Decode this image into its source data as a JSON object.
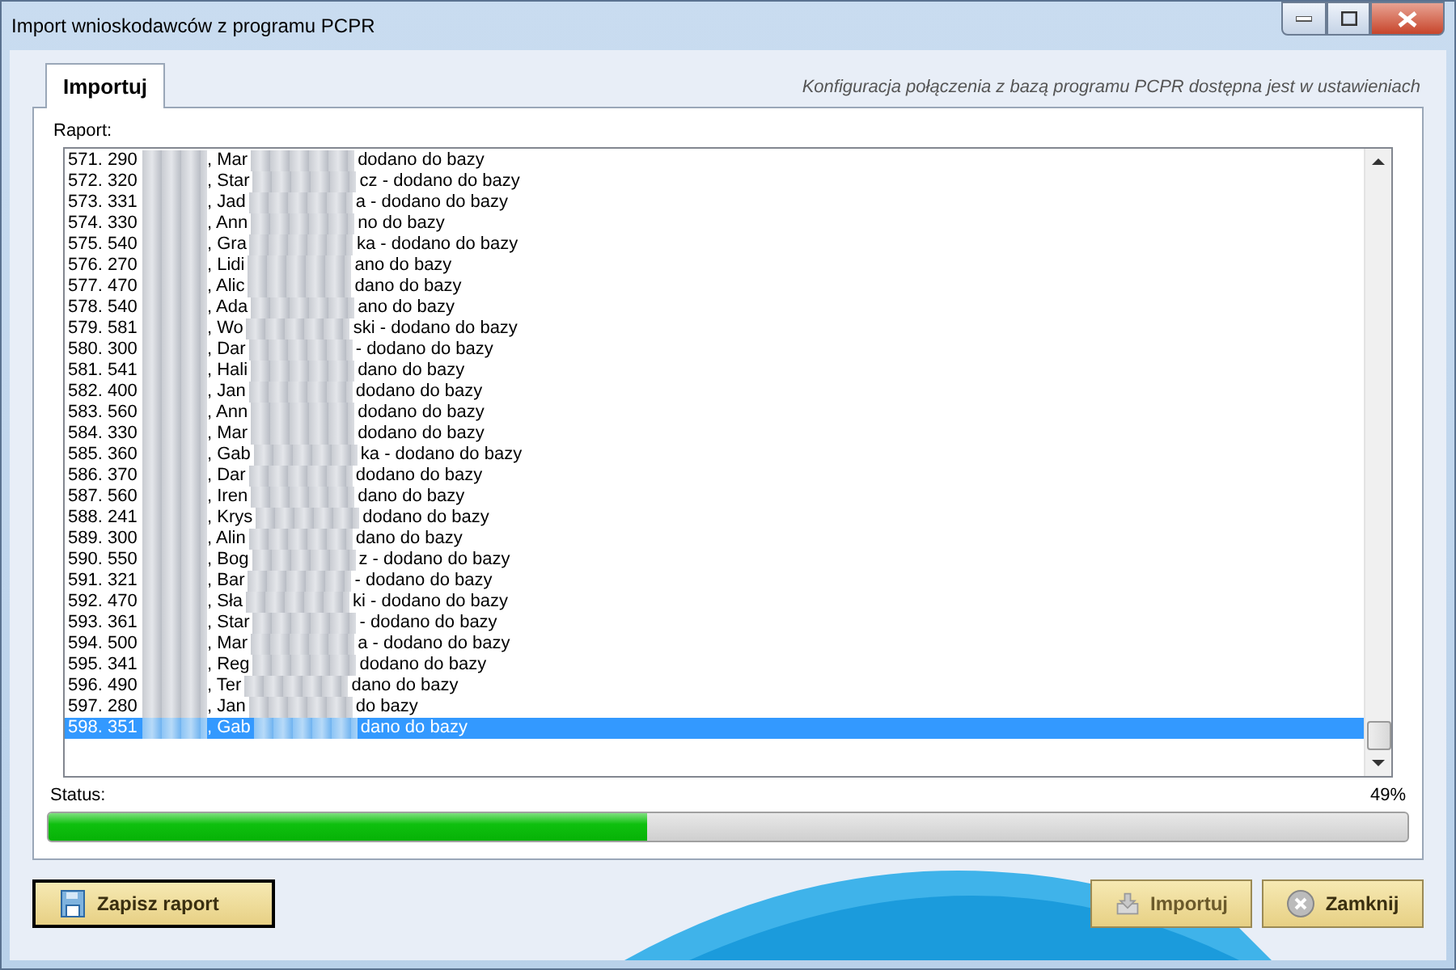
{
  "window": {
    "title": "Import wnioskodawców z programu PCPR"
  },
  "tabs": [
    {
      "label": "Importuj",
      "selected": true
    }
  ],
  "config_note": "Konfiguracja połączenia z bazą programu PCPR dostępna jest w ustawieniach",
  "report": {
    "label": "Raport:",
    "rows": [
      {
        "number": "571. 290",
        "name": ", Mar",
        "tail": "dodano do bazy",
        "selected": false
      },
      {
        "number": "572. 320",
        "name": ", Star",
        "tail": "cz - dodano do bazy",
        "selected": false
      },
      {
        "number": "573. 331",
        "name": ", Jad",
        "tail": "a - dodano do bazy",
        "selected": false
      },
      {
        "number": "574. 330",
        "name": ", Ann",
        "tail": "no do bazy",
        "selected": false
      },
      {
        "number": "575. 540",
        "name": ", Gra",
        "tail": "ka - dodano do bazy",
        "selected": false
      },
      {
        "number": "576. 270",
        "name": ", Lidi",
        "tail": "ano do bazy",
        "selected": false
      },
      {
        "number": "577. 470",
        "name": ", Alic",
        "tail": "dano do bazy",
        "selected": false
      },
      {
        "number": "578. 540",
        "name": ", Ada",
        "tail": "ano do bazy",
        "selected": false
      },
      {
        "number": "579. 581",
        "name": ", Wo",
        "tail": "ski - dodano do bazy",
        "selected": false
      },
      {
        "number": "580. 300",
        "name": ", Dar",
        "tail": "- dodano do bazy",
        "selected": false
      },
      {
        "number": "581. 541",
        "name": ", Hali",
        "tail": "dano do bazy",
        "selected": false
      },
      {
        "number": "582. 400",
        "name": ", Jan",
        "tail": "dodano do bazy",
        "selected": false
      },
      {
        "number": "583. 560",
        "name": ", Ann",
        "tail": "dodano do bazy",
        "selected": false
      },
      {
        "number": "584. 330",
        "name": ", Mar",
        "tail": "dodano do bazy",
        "selected": false
      },
      {
        "number": "585. 360",
        "name": ", Gab",
        "tail": "ka - dodano do bazy",
        "selected": false
      },
      {
        "number": "586. 370",
        "name": ", Dar",
        "tail": "dodano do bazy",
        "selected": false
      },
      {
        "number": "587. 560",
        "name": ", Iren",
        "tail": "dano do bazy",
        "selected": false
      },
      {
        "number": "588. 241",
        "name": ", Krys",
        "tail": "dodano do bazy",
        "selected": false
      },
      {
        "number": "589. 300",
        "name": ", Alin",
        "tail": "dano do bazy",
        "selected": false
      },
      {
        "number": "590. 550",
        "name": ", Bog",
        "tail": "z - dodano do bazy",
        "selected": false
      },
      {
        "number": "591. 321",
        "name": ", Bar",
        "tail": "- dodano do bazy",
        "selected": false
      },
      {
        "number": "592. 470",
        "name": ", Sła",
        "tail": "ki - dodano do bazy",
        "selected": false
      },
      {
        "number": "593. 361",
        "name": ", Star",
        "tail": "- dodano do bazy",
        "selected": false
      },
      {
        "number": "594. 500",
        "name": ", Mar",
        "tail": "a - dodano do bazy",
        "selected": false
      },
      {
        "number": "595. 341",
        "name": ", Reg",
        "tail": "dodano do bazy",
        "selected": false
      },
      {
        "number": "596. 490",
        "name": ", Ter",
        "tail": "dano do bazy",
        "selected": false
      },
      {
        "number": "597. 280",
        "name": ", Jan",
        "tail": "do bazy",
        "selected": false
      },
      {
        "number": "598. 351",
        "name": ", Gab",
        "tail": "dano do bazy",
        "selected": true
      }
    ]
  },
  "status": {
    "label": "Status:",
    "percent": "49%",
    "level": 0.44
  },
  "buttons": [
    {
      "kind": "save",
      "label": "Zapisz raport",
      "disabled": false
    },
    {
      "kind": "import",
      "label": "Importuj",
      "disabled": true
    },
    {
      "kind": "close",
      "label": "Zamknij",
      "disabled": false
    }
  ]
}
